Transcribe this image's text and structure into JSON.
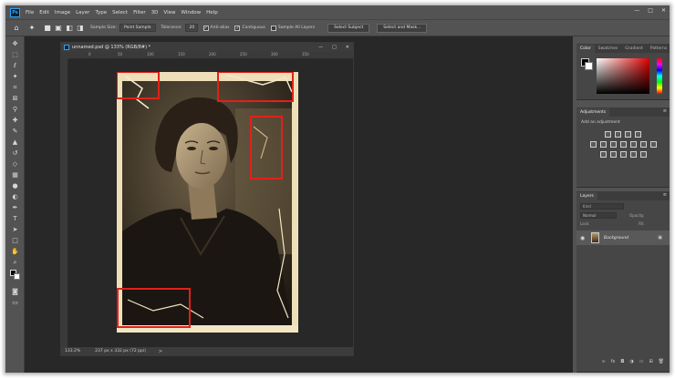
{
  "menu": {
    "logo": "Ps",
    "items": [
      "File",
      "Edit",
      "Image",
      "Layer",
      "Type",
      "Select",
      "Filter",
      "3D",
      "View",
      "Window",
      "Help"
    ],
    "window_controls": [
      "—",
      "□",
      "✕"
    ]
  },
  "options_bar": {
    "sample_size_label": "Sample Size:",
    "sample_size_value": "Point Sample",
    "tolerance_label": "Tolerance:",
    "tolerance_value": "20",
    "anti_alias_label": "Anti-alias",
    "contiguous_label": "Contiguous",
    "sample_all_layers_label": "Sample All Layers",
    "select_subject_label": "Select Subject",
    "select_and_mask_label": "Select and Mask..."
  },
  "document": {
    "title": "unnamed.psd @ 133% (RGB/8#) *",
    "ruler_ticks": [
      "0",
      "50",
      "100",
      "150",
      "200",
      "250",
      "300",
      "350"
    ],
    "zoom": "133.2%",
    "info": "237 px x 332 px (72 ppi)",
    "status_arrow": ">",
    "controls": [
      "—",
      "□",
      "✕"
    ]
  },
  "panels": {
    "color_tabs": [
      "Color",
      "Swatches",
      "Gradient",
      "Patterns"
    ],
    "adjustments_tab": "Adjustments",
    "adjustments_label": "Add an adjustment",
    "layers_tab": "Layers",
    "layers_search": "Kind",
    "blend_mode": "Normal",
    "opacity_label": "Opacity:",
    "lock_label": "Lock:",
    "fill_label": "Fill:",
    "layer_name": "Background",
    "menu_icon": "≡"
  },
  "icons": {
    "tools": [
      "move-icon",
      "marquee-icon",
      "lasso-icon",
      "magic-wand-icon",
      "crop-icon",
      "frame-icon",
      "eyedropper-icon",
      "healing-icon",
      "brush-icon",
      "stamp-icon",
      "history-brush-icon",
      "eraser-icon",
      "gradient-icon",
      "blur-icon",
      "dodge-icon",
      "pen-icon",
      "type-icon",
      "path-select-icon",
      "rectangle-icon",
      "hand-icon",
      "zoom-icon",
      "more-icon"
    ]
  },
  "colors": {
    "accent": "#2fa3f5",
    "highlight_box": "#e3201a"
  }
}
